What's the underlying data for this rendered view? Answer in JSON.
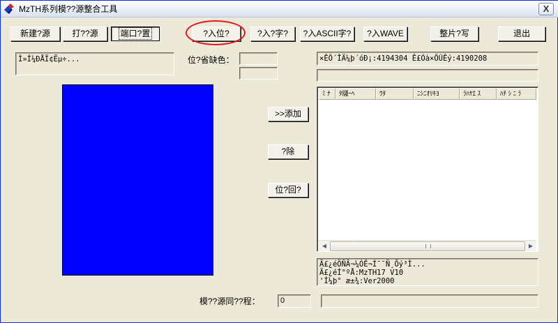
{
  "window": {
    "title": "MzTH系列模??源整合工具",
    "close_label": "X"
  },
  "toolbar": {
    "new_label": "新建?源",
    "open_label": "打??源",
    "port_settings_label": "端口?置",
    "import_bitmap_label": "?入位?",
    "import_font_label": "?入?字?",
    "import_ascii_label": "?入ASCII字?",
    "import_wave_label": "?入WAVE",
    "sort_write_label": "整片?写",
    "exit_label": "退出"
  },
  "left": {
    "info_text": "Ì»Í¼ÐÅÏ¢Ëµ÷...",
    "default_color_label": "位?省缺色：",
    "color_swatch": "#0000ff"
  },
  "buttons": {
    "add_label": ">>添加",
    "delete_label": "?除",
    "bitmap_back_label": "位?回?"
  },
  "right": {
    "space_info": "×ÊÔ´ÎÄ¼þ´óÐ¡:4194304  Ê£Óà×ÖÚÊý:4190208",
    "list_columns": [
      "ﾐ ﾅ",
      "ﾀ牋ｰﾍ",
      "ｳﾀ",
      "ﾆｼﾆｵﾘｷﾖ",
      "ﾗﾊﾔｴ ｽ",
      "ﾊﾁ ｼ ﾆ ﾗ"
    ],
    "status_lines": [
      "Ã£¿éÖÑÃ¬¼ÓÊ¬Í¯¯Ñ¸Õý³Ì...",
      "Ã£¿éÍ°ºÅ:MzTH17  V10",
      "'Í¼þ° æ±¾:Ver2000"
    ]
  },
  "footer": {
    "sync_label": "模??源同??程：",
    "progress_value": "0"
  },
  "colors": {
    "face": "#ece9d8",
    "accent_highlight": "#e0141c",
    "swatch_blue": "#0000ff"
  }
}
